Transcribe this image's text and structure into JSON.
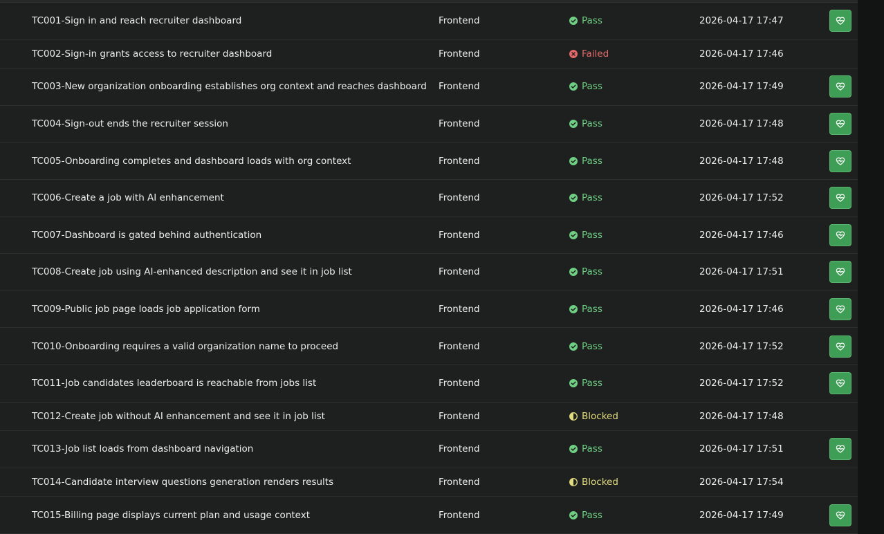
{
  "colors": {
    "pass": "#6fcf83",
    "failed": "#e46a6a",
    "blocked": "#e2dc7d",
    "action_button": "#3f9e56"
  },
  "rows": [
    {
      "name": "TC001-Sign in and reach recruiter dashboard",
      "type": "Frontend",
      "status": "Pass",
      "time": "2026-04-17 17:47",
      "action": "heart-pulse-icon"
    },
    {
      "name": "TC002-Sign-in grants access to recruiter dashboard",
      "type": "Frontend",
      "status": "Failed",
      "time": "2026-04-17 17:46",
      "action": null
    },
    {
      "name": "TC003-New organization onboarding establishes org context and reaches dashboard",
      "type": "Frontend",
      "status": "Pass",
      "time": "2026-04-17 17:49",
      "action": "heart-pulse-icon"
    },
    {
      "name": "TC004-Sign-out ends the recruiter session",
      "type": "Frontend",
      "status": "Pass",
      "time": "2026-04-17 17:48",
      "action": "heart-pulse-icon"
    },
    {
      "name": "TC005-Onboarding completes and dashboard loads with org context",
      "type": "Frontend",
      "status": "Pass",
      "time": "2026-04-17 17:48",
      "action": "heart-pulse-icon"
    },
    {
      "name": "TC006-Create a job with AI enhancement",
      "type": "Frontend",
      "status": "Pass",
      "time": "2026-04-17 17:52",
      "action": "heart-pulse-icon"
    },
    {
      "name": "TC007-Dashboard is gated behind authentication",
      "type": "Frontend",
      "status": "Pass",
      "time": "2026-04-17 17:46",
      "action": "heart-pulse-icon"
    },
    {
      "name": "TC008-Create job using AI-enhanced description and see it in job list",
      "type": "Frontend",
      "status": "Pass",
      "time": "2026-04-17 17:51",
      "action": "heart-pulse-icon"
    },
    {
      "name": "TC009-Public job page loads job application form",
      "type": "Frontend",
      "status": "Pass",
      "time": "2026-04-17 17:46",
      "action": "heart-pulse-icon"
    },
    {
      "name": "TC010-Onboarding requires a valid organization name to proceed",
      "type": "Frontend",
      "status": "Pass",
      "time": "2026-04-17 17:52",
      "action": "heart-pulse-icon"
    },
    {
      "name": "TC011-Job candidates leaderboard is reachable from jobs list",
      "type": "Frontend",
      "status": "Pass",
      "time": "2026-04-17 17:52",
      "action": "heart-pulse-icon"
    },
    {
      "name": "TC012-Create job without AI enhancement and see it in job list",
      "type": "Frontend",
      "status": "Blocked",
      "time": "2026-04-17 17:48",
      "action": null
    },
    {
      "name": "TC013-Job list loads from dashboard navigation",
      "type": "Frontend",
      "status": "Pass",
      "time": "2026-04-17 17:51",
      "action": "heart-pulse-icon"
    },
    {
      "name": "TC014-Candidate interview questions generation renders results",
      "type": "Frontend",
      "status": "Blocked",
      "time": "2026-04-17 17:54",
      "action": null
    },
    {
      "name": "TC015-Billing page displays current plan and usage context",
      "type": "Frontend",
      "status": "Pass",
      "time": "2026-04-17 17:49",
      "action": "heart-pulse-icon"
    }
  ]
}
